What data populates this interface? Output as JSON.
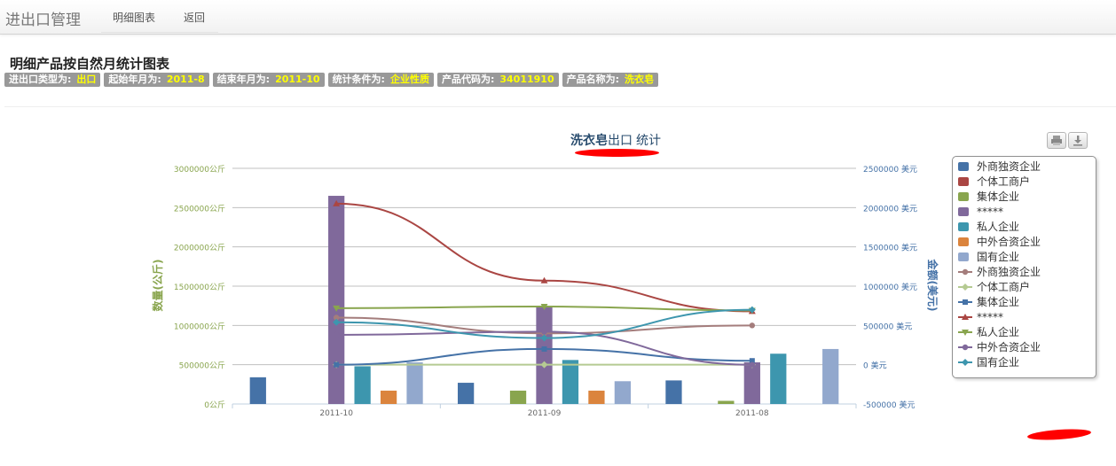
{
  "nav": {
    "brand": "进出口管理",
    "detail_chart": "明细图表",
    "back": "返回"
  },
  "page": {
    "title": "明细产品按自然月统计图表",
    "filters": [
      {
        "label": "进出口类型为:",
        "value": "出口"
      },
      {
        "label": "起始年月为:",
        "value": "2011-8"
      },
      {
        "label": "结束年月为:",
        "value": "2011-10"
      },
      {
        "label": "统计条件为:",
        "value": "企业性质"
      },
      {
        "label": "产品代码为:",
        "value": "34011910"
      },
      {
        "label": "产品名称为:",
        "value": "洗衣皂"
      }
    ]
  },
  "chart_data": {
    "type": "bar",
    "title": {
      "product": "洗衣皂",
      "kind": "出口",
      "suffix": "统计"
    },
    "categories": [
      "2011-10",
      "2011-09",
      "2011-08"
    ],
    "ylabel_left": "数量(公斤)",
    "ylabel_right": "金额(美元)",
    "ylim_left": [
      0,
      3000000
    ],
    "ylim_right": [
      -500000,
      2500000
    ],
    "yticks_left": [
      "0公斤",
      "500000公斤",
      "1000000公斤",
      "1500000公斤",
      "2000000公斤",
      "2500000公斤",
      "3000000公斤"
    ],
    "yticks_right": [
      "-500000 美元",
      "0 美元",
      "500000 美元",
      "1000000 美元",
      "1500000 美元",
      "2000000 美元",
      "2500000 美元"
    ],
    "legend_position": "right",
    "bar_series": [
      {
        "name": "外商独资企业",
        "color": "#4572A7",
        "values": [
          340000,
          270000,
          300000
        ]
      },
      {
        "name": "个体工商户",
        "color": "#AA4643",
        "values": [
          0,
          0,
          0
        ]
      },
      {
        "name": "集体企业",
        "color": "#89A54E",
        "values": [
          0,
          170000,
          40000
        ]
      },
      {
        "name": "*****",
        "color": "#80699B",
        "values": [
          2650000,
          1230000,
          530000
        ]
      },
      {
        "name": "私人企业",
        "color": "#3D96AE",
        "values": [
          480000,
          560000,
          640000
        ]
      },
      {
        "name": "中外合资企业",
        "color": "#DB843D",
        "values": [
          170000,
          170000,
          0
        ]
      },
      {
        "name": "国有企业",
        "color": "#92A8CD",
        "values": [
          530000,
          290000,
          700000
        ]
      }
    ],
    "line_series": [
      {
        "name": "外商独资企业",
        "color": "#A47D7C",
        "symbol": "circle",
        "values": [
          600000,
          400000,
          500000
        ]
      },
      {
        "name": "个体工商户",
        "color": "#B5CA92",
        "symbol": "diamond",
        "values": [
          0,
          0,
          0
        ]
      },
      {
        "name": "集体企业",
        "color": "#4572A7",
        "symbol": "square",
        "values": [
          0,
          200000,
          50000
        ]
      },
      {
        "name": "*****",
        "color": "#AA4643",
        "symbol": "triangle",
        "values": [
          2050000,
          1070000,
          680000
        ]
      },
      {
        "name": "私人企业",
        "color": "#89A54E",
        "symbol": "triangle-down",
        "values": [
          720000,
          740000,
          690000
        ]
      },
      {
        "name": "中外合资企业",
        "color": "#80699B",
        "symbol": "circle",
        "values": [
          380000,
          420000,
          0
        ]
      },
      {
        "name": "国有企业",
        "color": "#3D96AE",
        "symbol": "diamond",
        "values": [
          540000,
          340000,
          700000
        ]
      }
    ]
  }
}
